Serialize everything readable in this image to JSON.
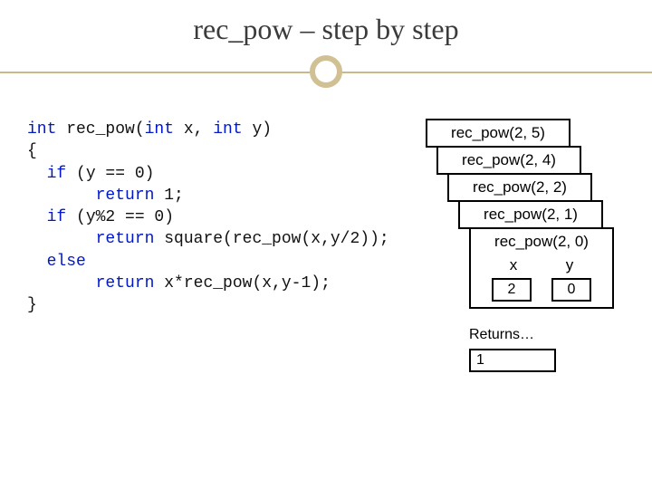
{
  "title": "rec_pow – step by step",
  "code": {
    "sig_pre": "int",
    "sig_name": " rec_pow(",
    "sig_t1": "int",
    "sig_mid1": " x, ",
    "sig_t2": "int",
    "sig_mid2": " y)",
    "open": "{",
    "l1a": "  ",
    "kw_if1": "if",
    "l1b": " (y == 0)",
    "l2a": "       ",
    "kw_ret1": "return",
    "l2b": " 1;",
    "l3a": "  ",
    "kw_if2": "if",
    "l3b": " (y%2 == 0)",
    "l4a": "       ",
    "kw_ret2": "return",
    "l4b": " square(rec_pow(x,y/2));",
    "l5a": "  ",
    "kw_else": "else",
    "l6a": "       ",
    "kw_ret3": "return",
    "l6b": " x*rec_pow(x,y-1);",
    "close": "}"
  },
  "stack": {
    "c0": "rec_pow(2, 5)",
    "c1": "rec_pow(2, 4)",
    "c2": "rec_pow(2, 2)",
    "c3": "rec_pow(2, 1)",
    "c4": "rec_pow(2, 0)",
    "xh": "x",
    "yh": "y",
    "xv": "2",
    "yv": "0"
  },
  "ret": {
    "label": "Returns…",
    "value": "1"
  }
}
